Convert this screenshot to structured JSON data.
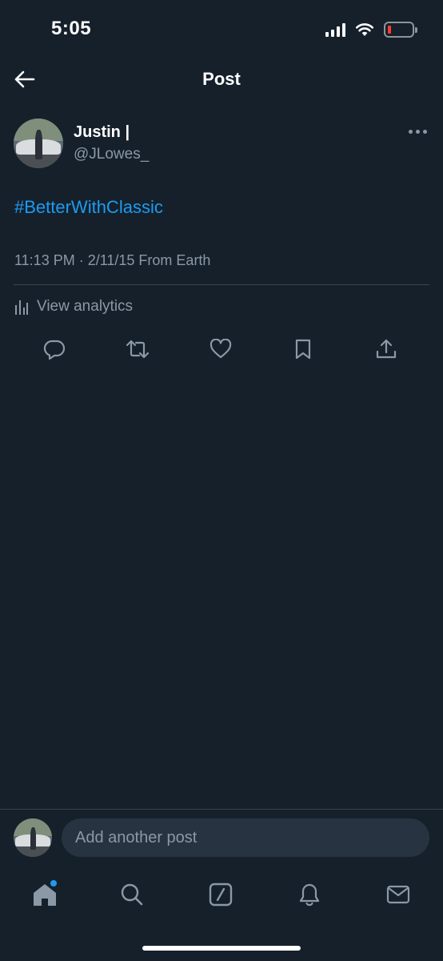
{
  "status_bar": {
    "time": "5:05"
  },
  "header": {
    "title": "Post"
  },
  "post": {
    "author_name": "Justin |",
    "author_handle": "@JLowes_",
    "hashtag": "#BetterWithClassic",
    "meta": "11:13 PM · 2/11/15 From Earth",
    "analytics_label": "View analytics"
  },
  "reply": {
    "placeholder": "Add another post"
  },
  "colors": {
    "background": "#15202b",
    "accent": "#1d9bf0",
    "secondary_text": "#8b98a5",
    "battery_low": "#ff3b30"
  },
  "icons": {
    "header": [
      "back-arrow-icon",
      "more-options-icon"
    ],
    "actions": [
      "reply-icon",
      "repost-icon",
      "like-icon",
      "bookmark-icon",
      "share-icon"
    ],
    "tabs": [
      "home-icon",
      "search-icon",
      "grok-icon",
      "notifications-icon",
      "messages-icon"
    ],
    "status": [
      "signal-icon",
      "wifi-icon",
      "battery-icon"
    ]
  }
}
